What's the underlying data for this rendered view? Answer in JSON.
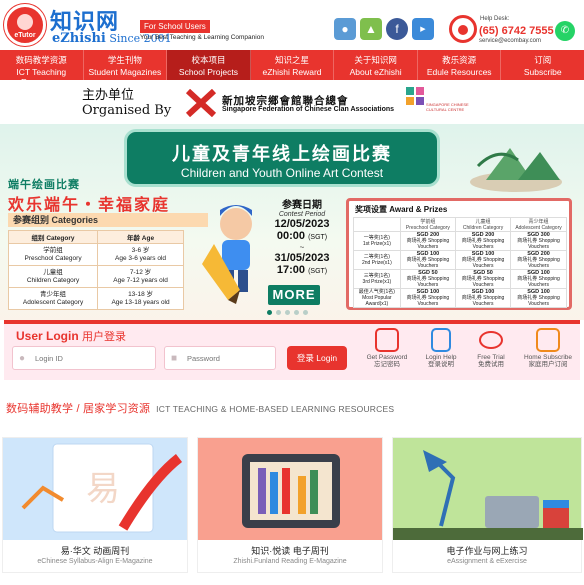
{
  "brand": {
    "badge": "eTutor",
    "name_cn": "知识网",
    "name_en": "eZhishi",
    "since": "Since 2001",
    "school_tag": "For School Users",
    "tagline": "Your Best Teaching & Learning Companion"
  },
  "help": {
    "label": "Help Desk:",
    "phone": "(65) 6742 7555",
    "email": "service@ecombay.com"
  },
  "nav": [
    {
      "cn": "数码教学资源",
      "en": "ICT Teaching Resources",
      "active": false
    },
    {
      "cn": "学生刊物",
      "en": "Student Magazines",
      "active": false
    },
    {
      "cn": "校本项目",
      "en": "School Projects",
      "active": true
    },
    {
      "cn": "知识之星",
      "en": "eZhishi Reward",
      "active": false
    },
    {
      "cn": "关于知识网",
      "en": "About eZhishi",
      "active": false
    },
    {
      "cn": "教乐资源",
      "en": "Edule Resources",
      "active": false
    },
    {
      "cn": "订阅",
      "en": "Subscribe",
      "active": false
    }
  ],
  "organiser": {
    "label_cn": "主办单位",
    "label_en": "Organised By",
    "sfcca_cn": "新加坡宗鄉會館聯合總會",
    "sfcca_en": "Singapore Federation of Chinese Clan Associations",
    "sccc": "SINGAPORE CHINESE CULTURAL CENTRE"
  },
  "banner": {
    "title_cn": "儿童及青年线上绘画比赛",
    "title_en": "Children and Youth Online Art Contest",
    "festival_label": "端午绘画比赛",
    "festival_title": "欢乐端午・幸福家庭",
    "categories_title": "参赛组别 Categories",
    "category_headers": [
      "组别 Category",
      "年龄 Age"
    ],
    "categories": [
      {
        "cn": "学前组",
        "en": "Preschool Category",
        "age_cn": "3-6 岁",
        "age_en": "Age 3-6 years old"
      },
      {
        "cn": "儿童组",
        "en": "Children Category",
        "age_cn": "7-12 岁",
        "age_en": "Age 7-12 years old"
      },
      {
        "cn": "青少年组",
        "en": "Adolescent Category",
        "age_cn": "13-18 岁",
        "age_en": "Age 13-18 years old"
      }
    ],
    "period_cn": "参赛日期",
    "period_en": "Contest Period",
    "start_date": "12/05/2023",
    "start_time": "00:00",
    "sep": "~",
    "end_date": "31/05/2023",
    "end_time": "17:00",
    "tz": "(SGT)",
    "more_label": "MORE",
    "awards_title": "奖项设置 Award & Prizes",
    "award_headers": [
      {
        "cn": "学前组",
        "en": "Preschool Category"
      },
      {
        "cn": "儿童组",
        "en": "Children Category"
      },
      {
        "cn": "青少年组",
        "en": "Adolescent Category"
      }
    ],
    "awards": [
      {
        "prize_cn": "一等奖(1名)",
        "prize_en": "1st Prize(x1)",
        "values": [
          "SGD 200",
          "SGD 200",
          "SGD 300"
        ]
      },
      {
        "prize_cn": "二等奖(1名)",
        "prize_en": "2nd Prize(x1)",
        "values": [
          "SGD 100",
          "SGD 100",
          "SGD 200"
        ]
      },
      {
        "prize_cn": "三等奖(1名)",
        "prize_en": "3rd Prize(x1)",
        "values": [
          "SGD 50",
          "SGD 50",
          "SGD 100"
        ]
      },
      {
        "prize_cn": "最佳人气奖(1名)",
        "prize_en": "Most Popular Award(x1)",
        "values": [
          "SGD 100",
          "SGD 100",
          "SGD 100"
        ]
      }
    ],
    "voucher_note": "商场礼券 Shopping Vouchers"
  },
  "login": {
    "title_en": "User Login",
    "title_cn": "用户登录",
    "id_placeholder": "Login ID",
    "password_placeholder": "Password",
    "button": "登录 Login",
    "links": [
      {
        "en": "Get Password",
        "cn": "忘记密码",
        "icon": "key-icon",
        "color": "#e8342e"
      },
      {
        "en": "Login Help",
        "cn": "登录说明",
        "icon": "document-icon",
        "color": "#2f8ae0"
      },
      {
        "en": "Free Trial",
        "cn": "免费试用",
        "icon": "eye-icon",
        "color": "#e8342e"
      },
      {
        "en": "Home Subscribe",
        "cn": "家庭用户订阅",
        "icon": "award-icon",
        "color": "#f08a1c"
      }
    ]
  },
  "resources": {
    "title_cn": "数码辅助教学 / 居家学习资源",
    "title_en": "ICT TEACHING & HOME-BASED LEARNING RESOURCES",
    "cards": [
      {
        "cn": "易·华文 动画周刊",
        "en": "eChinese Syllabus-Align E-Magazine",
        "bg": "#cfe6fb",
        "icon": "animation-magazine-icon"
      },
      {
        "cn": "知识·悦读 电子周刊",
        "en": "Zhishi.Funland Reading E-Magazine",
        "bg": "#f9a08f",
        "icon": "ereader-icon"
      },
      {
        "cn": "电子作业与网上练习",
        "en": "eAssignment & eExercise",
        "bg": "#bfe49a",
        "icon": "desk-lamp-icon"
      }
    ]
  }
}
